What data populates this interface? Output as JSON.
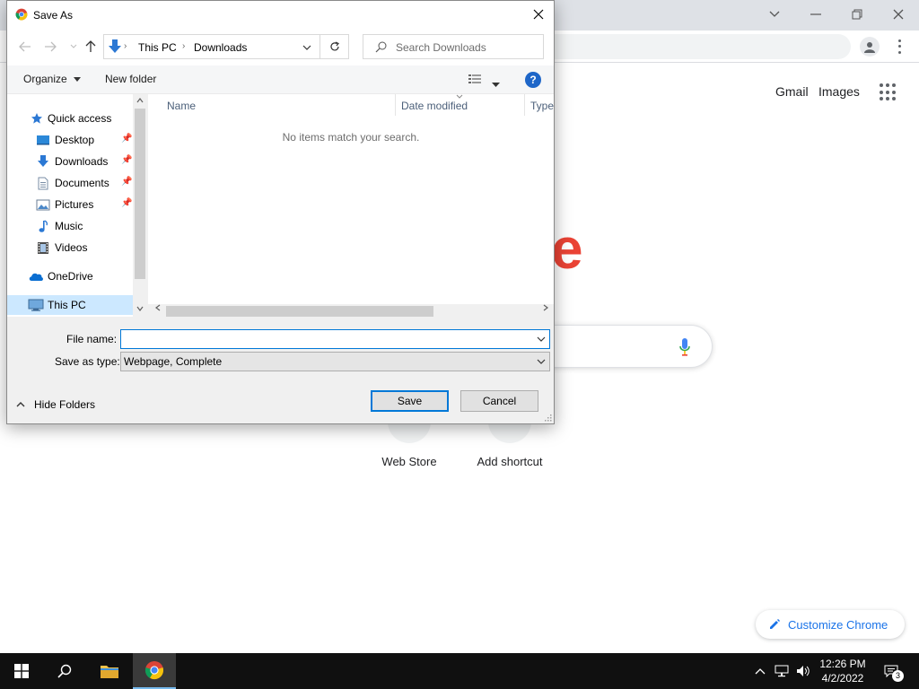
{
  "chrome": {
    "gmail_label": "Gmail",
    "images_label": "Images",
    "shortcuts": [
      {
        "label": "Web Store"
      },
      {
        "label": "Add shortcut"
      }
    ],
    "customize_label": "Customize Chrome",
    "logo_partial": "e",
    "logo_color": "#ea4335",
    "accent_color": "#1a73e8"
  },
  "dialog": {
    "title": "Save As",
    "breadcrumb": [
      "This PC",
      "Downloads"
    ],
    "search_placeholder": "Search Downloads",
    "toolbar": {
      "organize_label": "Organize",
      "new_folder_label": "New folder",
      "help_label": "?"
    },
    "nav_items": [
      {
        "label": "Quick access",
        "icon": "star-icon"
      },
      {
        "label": "Desktop",
        "icon": "desktop-icon",
        "pinned": true
      },
      {
        "label": "Downloads",
        "icon": "download-arrow-icon",
        "pinned": true
      },
      {
        "label": "Documents",
        "icon": "document-icon",
        "pinned": true
      },
      {
        "label": "Pictures",
        "icon": "picture-icon",
        "pinned": true
      },
      {
        "label": "Music",
        "icon": "music-note-icon"
      },
      {
        "label": "Videos",
        "icon": "film-icon"
      },
      {
        "label": "OneDrive",
        "icon": "cloud-icon"
      },
      {
        "label": "This PC",
        "icon": "computer-icon",
        "selected": true
      }
    ],
    "columns": [
      "Name",
      "Date modified",
      "Type"
    ],
    "empty_message": "No items match your search.",
    "file_name_label": "File name:",
    "file_name_value": "",
    "save_type_label": "Save as type:",
    "save_type_value": "Webpage, Complete",
    "hide_folders_label": "Hide Folders",
    "save_label": "Save",
    "cancel_label": "Cancel",
    "selection_color": "#cce8ff",
    "focus_color": "#0078d7"
  },
  "taskbar": {
    "time": "12:26 PM",
    "date": "4/2/2022",
    "notification_count": "3"
  }
}
